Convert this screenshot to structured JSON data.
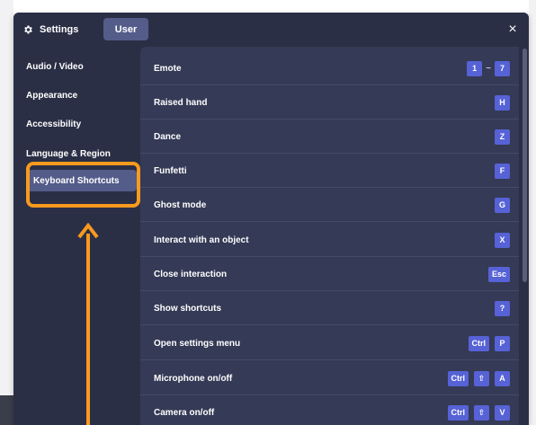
{
  "header": {
    "settings_label": "Settings",
    "user_tab": "User",
    "close_glyph": "×",
    "gear_icon": "gear-icon"
  },
  "sidebar": {
    "items": [
      {
        "label": "Audio / Video",
        "active": false
      },
      {
        "label": "Appearance",
        "active": false
      },
      {
        "label": "Accessibility",
        "active": false
      },
      {
        "label": "Language & Region",
        "active": false
      },
      {
        "label": "Keyboard Shortcuts",
        "active": true
      }
    ]
  },
  "shortcuts": [
    {
      "label": "Emote",
      "keys": [
        "1",
        "~",
        "7"
      ]
    },
    {
      "label": "Raised hand",
      "keys": [
        "H"
      ]
    },
    {
      "label": "Dance",
      "keys": [
        "Z"
      ]
    },
    {
      "label": "Funfetti",
      "keys": [
        "F"
      ]
    },
    {
      "label": "Ghost mode",
      "keys": [
        "G"
      ]
    },
    {
      "label": "Interact with an object",
      "keys": [
        "X"
      ]
    },
    {
      "label": "Close interaction",
      "keys": [
        "Esc"
      ]
    },
    {
      "label": "Show shortcuts",
      "keys": [
        "?"
      ]
    },
    {
      "label": "Open settings menu",
      "keys": [
        "Ctrl",
        "P"
      ]
    },
    {
      "label": "Microphone on/off",
      "keys": [
        "Ctrl",
        "⇧",
        "A"
      ]
    },
    {
      "label": "Camera on/off",
      "keys": [
        "Ctrl",
        "⇧",
        "V"
      ]
    }
  ],
  "colors": {
    "modal_bg": "#2b2f45",
    "content_bg": "#353a56",
    "key_bg": "#5662d6",
    "active_bg": "#545c8a",
    "highlight": "#f79a1e"
  }
}
